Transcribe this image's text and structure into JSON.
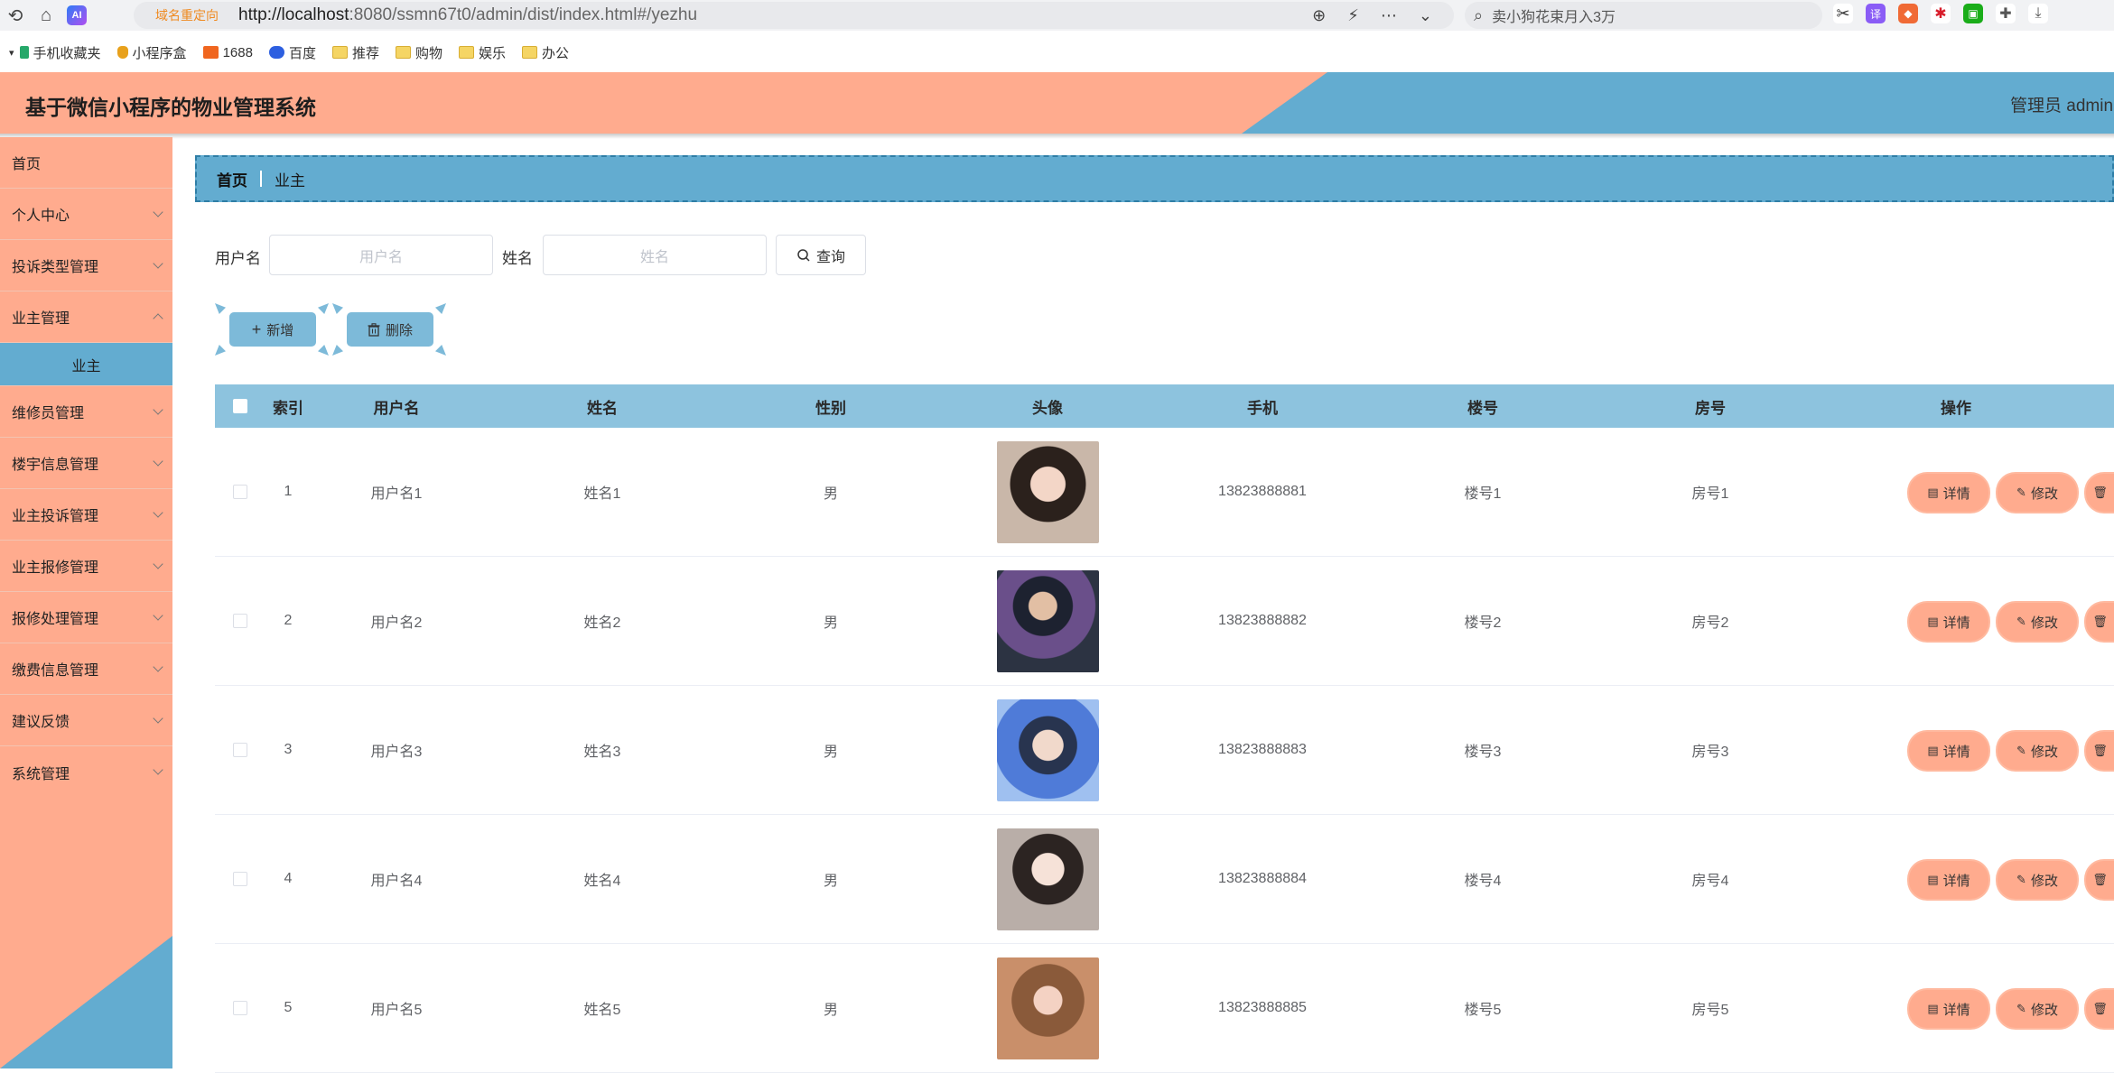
{
  "browser": {
    "nav": [
      "⟲",
      "⌂"
    ],
    "ai_badge": "AI",
    "redirect_tag": "域名重定向",
    "url_host": "http://localhost",
    "url_rest": ":8080/ssmn67t0/admin/dist/index.html#/yezhu",
    "search_text": "卖小狗花束月入3万",
    "ext_badge": "译"
  },
  "bookmarks": [
    {
      "label": "手机收藏夹",
      "icon": "phone-icon"
    },
    {
      "label": "小程序盒",
      "icon": "shield-icon"
    },
    {
      "label": "1688",
      "icon": "1688-icon"
    },
    {
      "label": "百度",
      "icon": "baidu-icon"
    },
    {
      "label": "推荐",
      "icon": "folder-icon"
    },
    {
      "label": "购物",
      "icon": "folder-icon"
    },
    {
      "label": "娱乐",
      "icon": "folder-icon"
    },
    {
      "label": "办公",
      "icon": "folder-icon"
    }
  ],
  "header": {
    "title": "基于微信小程序的物业管理系统",
    "user": "管理员 admin"
  },
  "sidebar": {
    "items": [
      {
        "label": "首页"
      },
      {
        "label": "个人中心"
      },
      {
        "label": "投诉类型管理"
      },
      {
        "label": "业主管理"
      },
      {
        "label": "维修员管理"
      },
      {
        "label": "楼宇信息管理"
      },
      {
        "label": "业主投诉管理"
      },
      {
        "label": "业主报修管理"
      },
      {
        "label": "报修处理管理"
      },
      {
        "label": "缴费信息管理"
      },
      {
        "label": "建议反馈"
      },
      {
        "label": "系统管理"
      }
    ],
    "active_sub": "业主"
  },
  "breadcrumb": {
    "home": "首页",
    "current": "业主"
  },
  "search": {
    "username_label": "用户名",
    "username_placeholder": "用户名",
    "name_label": "姓名",
    "name_placeholder": "姓名",
    "query_label": "查询"
  },
  "actions": {
    "add": "新增",
    "delete": "删除"
  },
  "table": {
    "columns": [
      "索引",
      "用户名",
      "姓名",
      "性别",
      "头像",
      "手机",
      "楼号",
      "房号",
      "操作"
    ],
    "op_labels": {
      "detail": "详情",
      "edit": "修改"
    },
    "rows": [
      {
        "index": "1",
        "username": "用户名1",
        "name": "姓名1",
        "gender": "男",
        "phone": "13823888881",
        "building": "楼号1",
        "room": "房号1"
      },
      {
        "index": "2",
        "username": "用户名2",
        "name": "姓名2",
        "gender": "男",
        "phone": "13823888882",
        "building": "楼号2",
        "room": "房号2"
      },
      {
        "index": "3",
        "username": "用户名3",
        "name": "姓名3",
        "gender": "男",
        "phone": "13823888883",
        "building": "楼号3",
        "room": "房号3"
      },
      {
        "index": "4",
        "username": "用户名4",
        "name": "姓名4",
        "gender": "男",
        "phone": "13823888884",
        "building": "楼号4",
        "room": "房号4"
      },
      {
        "index": "5",
        "username": "用户名5",
        "name": "姓名5",
        "gender": "男",
        "phone": "13823888885",
        "building": "楼号5",
        "room": "房号5"
      }
    ]
  },
  "colors": {
    "salmon": "#ffab8e",
    "blue": "#63acd0",
    "table_head": "#8dc3de"
  }
}
